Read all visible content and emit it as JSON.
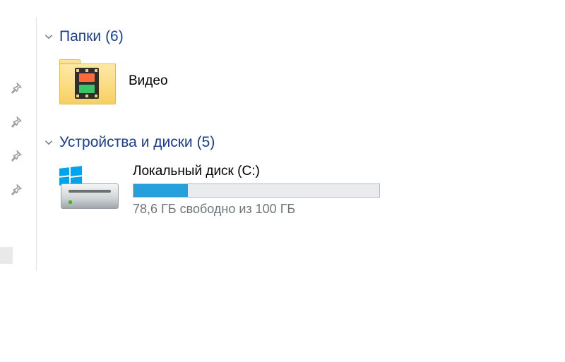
{
  "sidebar": {
    "pins": [
      "pin",
      "pin",
      "pin",
      "pin"
    ]
  },
  "groups": {
    "folders": {
      "label": "Папки",
      "count_display": "(6)",
      "items": [
        {
          "name": "Видео"
        }
      ]
    },
    "devices": {
      "label": "Устройства и диски",
      "count_display": "(5)",
      "items": [
        {
          "name": "Локальный диск (C:)",
          "free_text": "78,6 ГБ свободно из 100 ГБ",
          "used_percent": 22
        }
      ]
    }
  }
}
